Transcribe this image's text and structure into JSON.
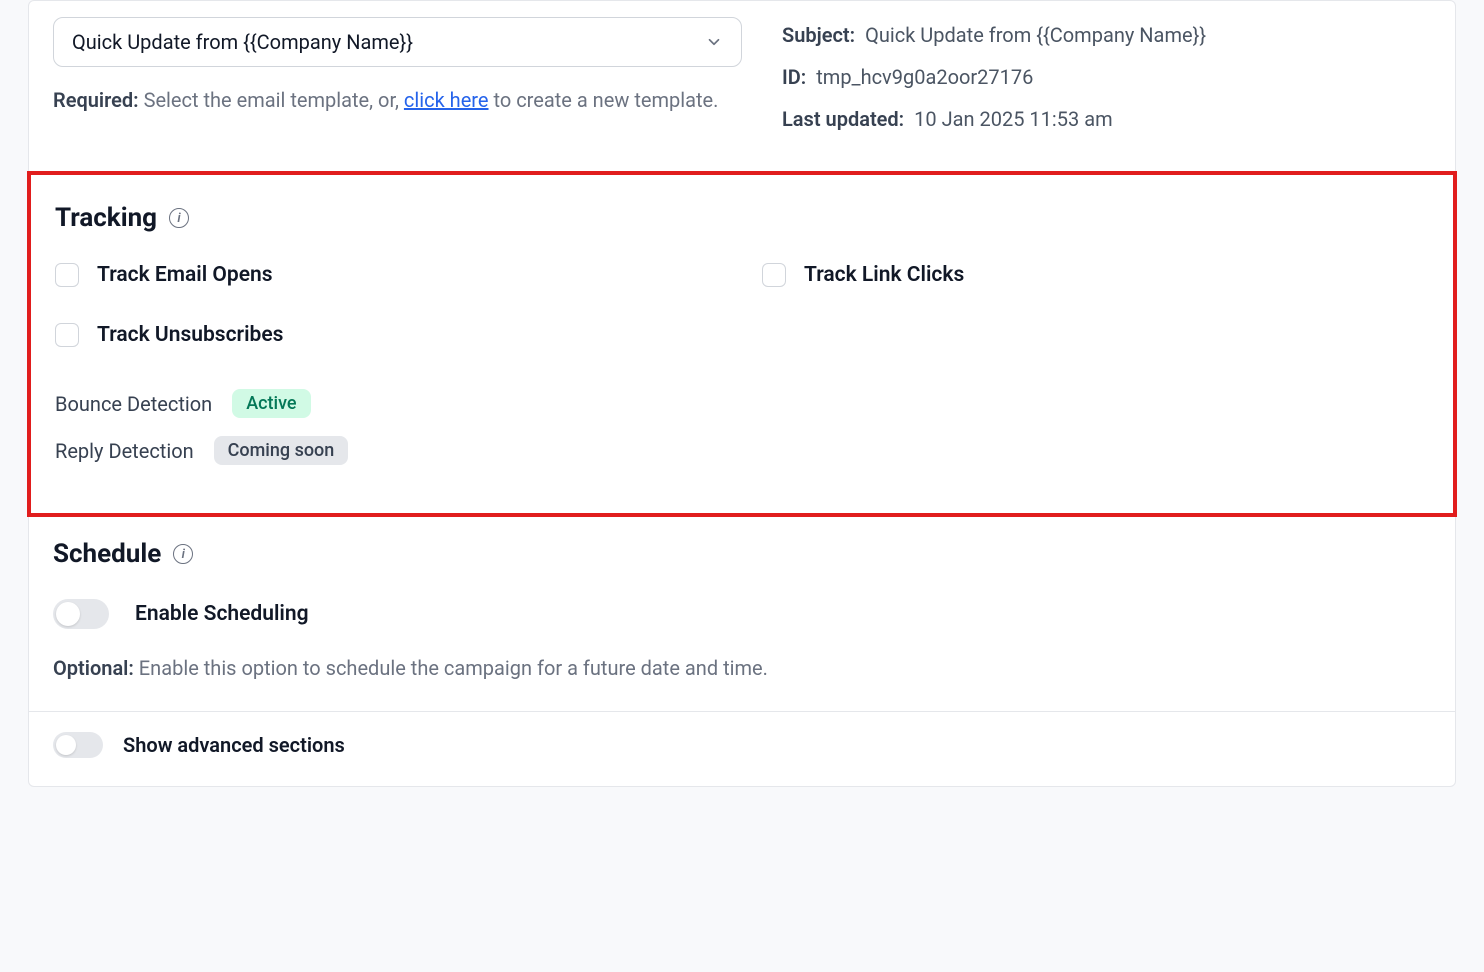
{
  "template": {
    "selected": "Quick Update from {{Company Name}}",
    "helper_prefix": "Required:",
    "helper_mid1": " Select the email template, or, ",
    "helper_link": "click here",
    "helper_suffix": " to create a new template."
  },
  "meta": {
    "subject_label": "Subject:",
    "subject_value": "Quick Update from {{Company Name}}",
    "id_label": "ID:",
    "id_value": "tmp_hcv9g0a2oor27176",
    "updated_label": "Last updated:",
    "updated_value": "10 Jan 2025 11:53 am"
  },
  "tracking": {
    "title": "Tracking",
    "opens_label": "Track Email Opens",
    "clicks_label": "Track Link Clicks",
    "unsub_label": "Track Unsubscribes",
    "bounce_label": "Bounce Detection",
    "bounce_badge": "Active",
    "reply_label": "Reply Detection",
    "reply_badge": "Coming soon"
  },
  "schedule": {
    "title": "Schedule",
    "enable_label": "Enable Scheduling",
    "helper_prefix": "Optional:",
    "helper_text": " Enable this option to schedule the campaign for a future date and time."
  },
  "advanced": {
    "label": "Show advanced sections"
  }
}
